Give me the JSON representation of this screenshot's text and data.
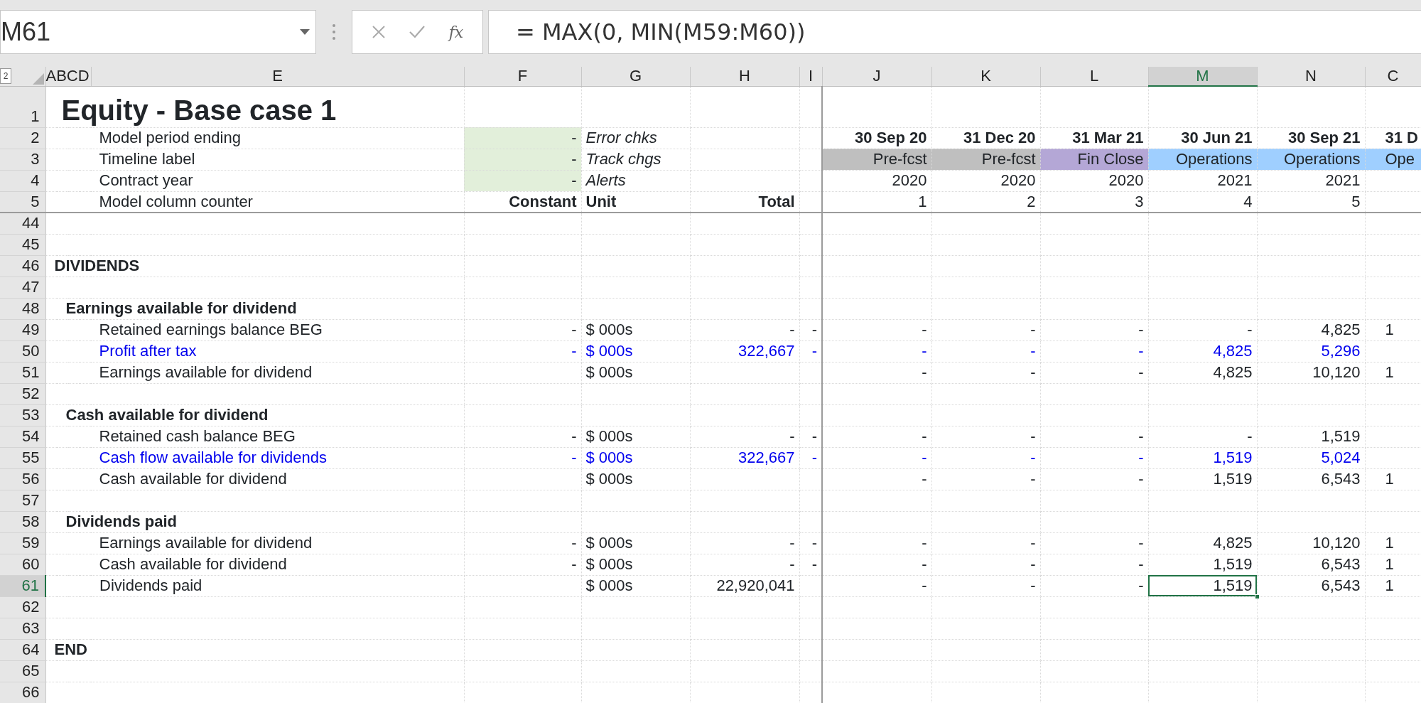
{
  "name_box": {
    "value": "M61"
  },
  "formula_bar": {
    "function_label": "fx",
    "value": "= MAX(0, MIN(M59:M60))"
  },
  "outline_level": "2",
  "columns": [
    {
      "label": "ABCD",
      "selected": false
    },
    {
      "label": "E",
      "selected": false
    },
    {
      "label": "F",
      "selected": false
    },
    {
      "label": "G",
      "selected": false
    },
    {
      "label": "H",
      "selected": false
    },
    {
      "label": "I",
      "selected": false
    },
    {
      "label": "J",
      "selected": false
    },
    {
      "label": "K",
      "selected": false
    },
    {
      "label": "L",
      "selected": false
    },
    {
      "label": "M",
      "selected": true
    },
    {
      "label": "N",
      "selected": false
    },
    {
      "label": "C",
      "selected": false
    }
  ],
  "header_rows": [
    {
      "number": "1",
      "selected": false,
      "label": {
        "text": "Equity - Base case 1",
        "kind": "title"
      }
    },
    {
      "number": "2",
      "selected": false,
      "label": {
        "text": "Model period ending",
        "kind": "item"
      },
      "cells": {
        "F": {
          "text": "-",
          "color": "#e2efda"
        },
        "G": {
          "text": "Error chks",
          "kind": "note"
        },
        "J": {
          "text": "30 Sep 20",
          "kind": "heading"
        },
        "K": {
          "text": "31 Dec 20",
          "kind": "heading"
        },
        "L": {
          "text": "31 Mar 21",
          "kind": "heading"
        },
        "M": {
          "text": "30 Jun 21",
          "kind": "heading"
        },
        "N": {
          "text": "30 Sep 21",
          "kind": "heading"
        },
        "O": {
          "text": "31 D",
          "kind": "heading"
        }
      }
    },
    {
      "number": "3",
      "selected": false,
      "label": {
        "text": "Timeline label",
        "kind": "item"
      },
      "cells": {
        "F": {
          "text": "-",
          "color": "#e2efda"
        },
        "G": {
          "text": "Track chgs",
          "kind": "note"
        },
        "J": {
          "text": "Pre-fcst",
          "color": "#bfbfbf"
        },
        "K": {
          "text": "Pre-fcst",
          "color": "#bfbfbf"
        },
        "L": {
          "text": "Fin Close",
          "color": "#b4a7d6"
        },
        "M": {
          "text": "Operations",
          "color": "#9fcfff"
        },
        "N": {
          "text": "Operations",
          "color": "#9fcfff"
        },
        "O": {
          "text": "Ope",
          "color": "#9fcfff"
        }
      }
    },
    {
      "number": "4",
      "selected": false,
      "label": {
        "text": "Contract year",
        "kind": "item"
      },
      "cells": {
        "F": {
          "text": "-",
          "color": "#e2efda"
        },
        "G": {
          "text": "Alerts",
          "kind": "note"
        },
        "J": {
          "text": "2020"
        },
        "K": {
          "text": "2020"
        },
        "L": {
          "text": "2020"
        },
        "M": {
          "text": "2021"
        },
        "N": {
          "text": "2021"
        }
      }
    },
    {
      "number": "5",
      "selected": false,
      "label": {
        "text": "Model column counter",
        "kind": "item"
      },
      "cells": {
        "F": {
          "text": "Constant",
          "kind": "heading"
        },
        "G": {
          "text": "Unit",
          "kind": "heading"
        },
        "H": {
          "text": "Total",
          "kind": "heading"
        },
        "J": {
          "text": "1"
        },
        "K": {
          "text": "2"
        },
        "L": {
          "text": "3"
        },
        "M": {
          "text": "4"
        },
        "N": {
          "text": "5"
        }
      }
    }
  ],
  "rows": [
    {
      "number": "44",
      "selected": false
    },
    {
      "number": "45",
      "selected": false
    },
    {
      "number": "46",
      "selected": false,
      "label": {
        "text": "DIVIDENDS",
        "kind": "section"
      }
    },
    {
      "number": "47",
      "selected": false
    },
    {
      "number": "48",
      "selected": false,
      "label": {
        "text": "Earnings available for dividend",
        "kind": "group"
      }
    },
    {
      "number": "49",
      "selected": false,
      "label": {
        "text": "Retained earnings balance BEG",
        "kind": "item"
      },
      "cells": {
        "F": {
          "text": "-"
        },
        "G": {
          "text": "$ 000s"
        },
        "H": {
          "text": "-"
        },
        "I": {
          "text": "-"
        },
        "J": {
          "text": "-"
        },
        "K": {
          "text": "-"
        },
        "L": {
          "text": "-"
        },
        "M": {
          "text": "-"
        },
        "N": {
          "text": "4,825"
        },
        "O": {
          "text": "1"
        }
      }
    },
    {
      "number": "50",
      "selected": false,
      "label": {
        "text": "Profit after tax",
        "kind": "input_item"
      },
      "cells": {
        "F": {
          "text": "-",
          "kind": "input"
        },
        "G": {
          "text": "$ 000s",
          "kind": "input"
        },
        "H": {
          "text": "322,667",
          "kind": "input"
        },
        "I": {
          "text": "-",
          "kind": "input"
        },
        "J": {
          "text": "-",
          "kind": "input"
        },
        "K": {
          "text": "-",
          "kind": "input"
        },
        "L": {
          "text": "-",
          "kind": "input"
        },
        "M": {
          "text": "4,825",
          "kind": "input"
        },
        "N": {
          "text": "5,296",
          "kind": "input"
        }
      }
    },
    {
      "number": "51",
      "selected": false,
      "label": {
        "text": "Earnings available for dividend",
        "kind": "item"
      },
      "cells": {
        "G": {
          "text": "$ 000s"
        },
        "J": {
          "text": "-"
        },
        "K": {
          "text": "-"
        },
        "L": {
          "text": "-"
        },
        "M": {
          "text": "4,825"
        },
        "N": {
          "text": "10,120"
        },
        "O": {
          "text": "1"
        }
      }
    },
    {
      "number": "52",
      "selected": false
    },
    {
      "number": "53",
      "selected": false,
      "label": {
        "text": "Cash available for dividend",
        "kind": "group"
      }
    },
    {
      "number": "54",
      "selected": false,
      "label": {
        "text": "Retained cash balance BEG",
        "kind": "item"
      },
      "cells": {
        "F": {
          "text": "-"
        },
        "G": {
          "text": "$ 000s"
        },
        "H": {
          "text": "-"
        },
        "I": {
          "text": "-"
        },
        "J": {
          "text": "-"
        },
        "K": {
          "text": "-"
        },
        "L": {
          "text": "-"
        },
        "M": {
          "text": "-"
        },
        "N": {
          "text": "1,519"
        }
      }
    },
    {
      "number": "55",
      "selected": false,
      "label": {
        "text": "Cash flow available for dividends",
        "kind": "input_item"
      },
      "cells": {
        "F": {
          "text": "-",
          "kind": "input"
        },
        "G": {
          "text": "$ 000s",
          "kind": "input"
        },
        "H": {
          "text": "322,667",
          "kind": "input"
        },
        "I": {
          "text": "-",
          "kind": "input"
        },
        "J": {
          "text": "-",
          "kind": "input"
        },
        "K": {
          "text": "-",
          "kind": "input"
        },
        "L": {
          "text": "-",
          "kind": "input"
        },
        "M": {
          "text": "1,519",
          "kind": "input"
        },
        "N": {
          "text": "5,024",
          "kind": "input"
        }
      }
    },
    {
      "number": "56",
      "selected": false,
      "label": {
        "text": "Cash available for dividend",
        "kind": "item"
      },
      "cells": {
        "G": {
          "text": "$ 000s"
        },
        "J": {
          "text": "-"
        },
        "K": {
          "text": "-"
        },
        "L": {
          "text": "-"
        },
        "M": {
          "text": "1,519"
        },
        "N": {
          "text": "6,543"
        },
        "O": {
          "text": "1"
        }
      }
    },
    {
      "number": "57",
      "selected": false
    },
    {
      "number": "58",
      "selected": false,
      "label": {
        "text": "Dividends paid",
        "kind": "group"
      }
    },
    {
      "number": "59",
      "selected": false,
      "label": {
        "text": "Earnings available for dividend",
        "kind": "item"
      },
      "cells": {
        "F": {
          "text": "-"
        },
        "G": {
          "text": "$ 000s"
        },
        "H": {
          "text": "-"
        },
        "I": {
          "text": "-"
        },
        "J": {
          "text": "-"
        },
        "K": {
          "text": "-"
        },
        "L": {
          "text": "-"
        },
        "M": {
          "text": "4,825"
        },
        "N": {
          "text": "10,120"
        },
        "O": {
          "text": "1"
        }
      }
    },
    {
      "number": "60",
      "selected": false,
      "label": {
        "text": "Cash available for dividend",
        "kind": "item"
      },
      "cells": {
        "F": {
          "text": "-"
        },
        "G": {
          "text": "$ 000s"
        },
        "H": {
          "text": "-"
        },
        "I": {
          "text": "-"
        },
        "J": {
          "text": "-"
        },
        "K": {
          "text": "-"
        },
        "L": {
          "text": "-"
        },
        "M": {
          "text": "1,519"
        },
        "N": {
          "text": "6,543"
        },
        "O": {
          "text": "1"
        }
      }
    },
    {
      "number": "61",
      "selected": true,
      "label": {
        "text": "Dividends paid",
        "kind": "item"
      },
      "cells": {
        "G": {
          "text": "$ 000s"
        },
        "H": {
          "text": "22,920,041"
        },
        "J": {
          "text": "-"
        },
        "K": {
          "text": "-"
        },
        "L": {
          "text": "-"
        },
        "M": {
          "text": "1,519"
        },
        "N": {
          "text": "6,543"
        },
        "O": {
          "text": "1"
        }
      }
    },
    {
      "number": "62",
      "selected": false
    },
    {
      "number": "63",
      "selected": false
    },
    {
      "number": "64",
      "selected": false,
      "label": {
        "text": "END",
        "kind": "section"
      }
    },
    {
      "number": "65",
      "selected": false
    },
    {
      "number": "66",
      "selected": false
    }
  ]
}
